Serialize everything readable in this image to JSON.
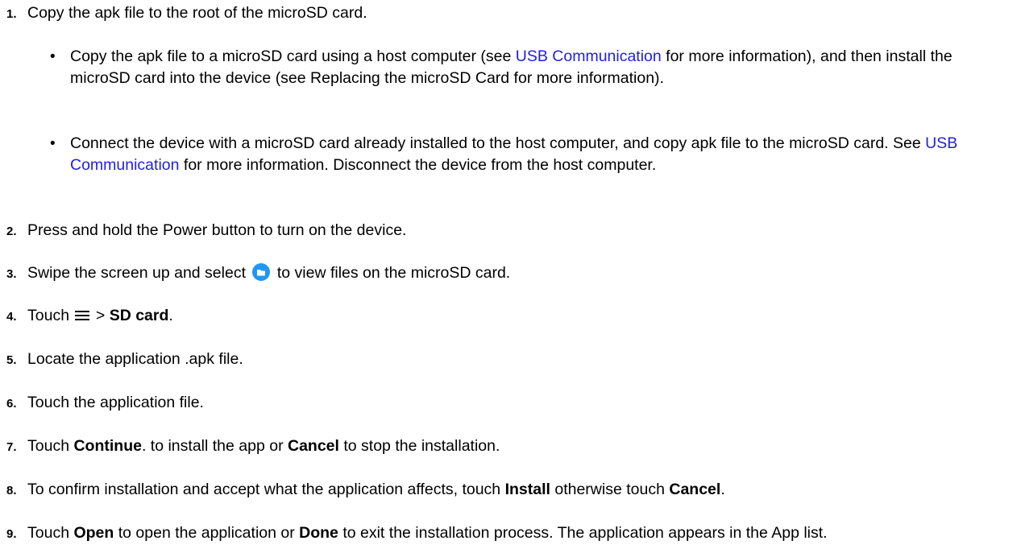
{
  "steps": [
    {
      "num": "1.",
      "text": "Copy the apk file to the root of the microSD card."
    },
    {
      "num": "2.",
      "text": "Press and hold the Power button to turn on the device."
    },
    {
      "num": "3.",
      "pre": "Swipe the screen up and select",
      "post": "to view files on the microSD card."
    },
    {
      "num": "4.",
      "pre": "Touch",
      "sep": ">",
      "bold": "SD card",
      "post": "."
    },
    {
      "num": "5.",
      "text": "Locate the application .apk file."
    },
    {
      "num": "6.",
      "text": "Touch the application file."
    },
    {
      "num": "7.",
      "pre": "Touch",
      "bold1": "Continue",
      "mid": ". to install the app or",
      "bold2": "Cancel",
      "post": "to stop the installation."
    },
    {
      "num": "8.",
      "pre": "To confirm installation and accept what the application affects, touch",
      "bold1": "Install",
      "mid": "otherwise touch",
      "bold2": "Cancel",
      "post": "."
    },
    {
      "num": "9.",
      "pre": "Touch",
      "bold1": "Open",
      "mid": "to open the application or",
      "bold2": "Done",
      "post": "to exit the installation process. The application appears in the App list."
    }
  ],
  "bullets": [
    {
      "dot": "•",
      "pre": "Copy the apk file to a microSD card using a host computer (see",
      "link": "USB Communication",
      "post": "for more information), and then install the microSD card into the device (see Replacing the microSD Card for more information)."
    },
    {
      "dot": "•",
      "pre": "Connect the device with a microSD card already installed to the host computer, and copy apk file to the microSD card. See",
      "link": "USB Communication",
      "post": "for more information. Disconnect the device from the host computer."
    }
  ],
  "icons": {
    "files_app": "folder-icon",
    "menu": "hamburger-menu-icon"
  },
  "colors": {
    "link": "#1f1fe0",
    "files_icon": "#2196f3"
  }
}
